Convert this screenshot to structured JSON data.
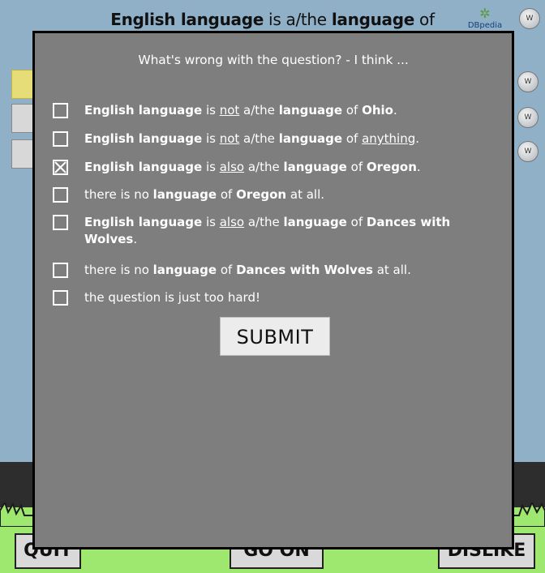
{
  "background": {
    "question": {
      "subject": "English language",
      "middle": " is a/the ",
      "predicate": "language",
      "tail": " of"
    },
    "logo_text": "DBpedia",
    "buttons": {
      "quit": "QUIT",
      "go_on": "GO ON",
      "dislike": "DISLIKE"
    }
  },
  "modal": {
    "heading": "What's wrong with the question? - I think ...",
    "options": [
      {
        "segments": [
          [
            "b",
            "English language"
          ],
          [
            "t",
            " is "
          ],
          [
            "u",
            "not"
          ],
          [
            "t",
            " a/the "
          ],
          [
            "b",
            "language"
          ],
          [
            "t",
            " of "
          ],
          [
            "b",
            "Ohio"
          ],
          [
            "t",
            "."
          ]
        ],
        "checked": false
      },
      {
        "segments": [
          [
            "b",
            "English language"
          ],
          [
            "t",
            " is "
          ],
          [
            "u",
            "not"
          ],
          [
            "t",
            " a/the "
          ],
          [
            "b",
            "language"
          ],
          [
            "t",
            " of "
          ],
          [
            "u",
            "anything"
          ],
          [
            "t",
            "."
          ]
        ],
        "checked": false
      },
      {
        "segments": [
          [
            "b",
            "English language"
          ],
          [
            "t",
            " is "
          ],
          [
            "u",
            "also"
          ],
          [
            "t",
            " a/the "
          ],
          [
            "b",
            "language"
          ],
          [
            "t",
            " of "
          ],
          [
            "b",
            "Oregon"
          ],
          [
            "t",
            "."
          ]
        ],
        "checked": true
      },
      {
        "segments": [
          [
            "t",
            "there is no "
          ],
          [
            "b",
            "language"
          ],
          [
            "t",
            " of "
          ],
          [
            "b",
            "Oregon"
          ],
          [
            "t",
            " at all."
          ]
        ],
        "checked": false
      },
      {
        "segments": [
          [
            "b",
            "English language"
          ],
          [
            "t",
            " is "
          ],
          [
            "u",
            "also"
          ],
          [
            "t",
            " a/the "
          ],
          [
            "b",
            "language"
          ],
          [
            "t",
            " of "
          ],
          [
            "b",
            "Dances with Wolves"
          ],
          [
            "t",
            "."
          ]
        ],
        "checked": false
      },
      {
        "segments": [
          [
            "t",
            "there is no "
          ],
          [
            "b",
            "language"
          ],
          [
            "t",
            " of "
          ],
          [
            "b",
            "Dances with Wolves"
          ],
          [
            "t",
            " at all."
          ]
        ],
        "checked": false
      },
      {
        "segments": [
          [
            "t",
            "the question is just too hard!"
          ]
        ],
        "checked": false
      }
    ],
    "submit_label": "SUBMIT"
  }
}
